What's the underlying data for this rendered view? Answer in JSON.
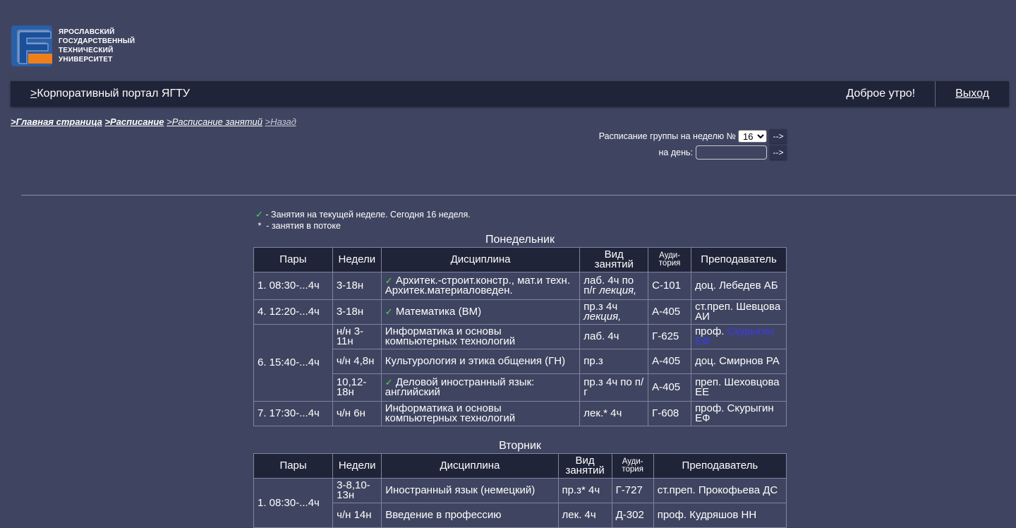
{
  "logo": {
    "lines": [
      "Ярославский",
      "государственный",
      "технический",
      "университет"
    ]
  },
  "navbar": {
    "portal_prefix": ">",
    "portal_label": "Корпоративный портал ЯГТУ",
    "greeting": "Доброе утро!",
    "logout": "Выход"
  },
  "breadcrumbs": {
    "home": ">Главная страница",
    "schedule": ">Расписание",
    "classes": ">Расписание занятий",
    "back": ">Назад"
  },
  "week_form": {
    "week_label": "Расписание группы на неделю №",
    "week_value": "16",
    "day_label": "на день:",
    "go": "-->"
  },
  "legend": {
    "check_text": " - Занятия на текущей неделе. Сегодня 16 неделя.",
    "star": "*",
    "star_text": "  - занятия в потоке"
  },
  "headers": {
    "pairs": "Пары",
    "weeks": "Недели",
    "discipline": "Дисциплина",
    "vid": "Вид занятий",
    "aud": "Ауди-тория",
    "teacher": "Преподаватель"
  },
  "monday": {
    "title": "Понедельник",
    "rows": [
      {
        "pair": "1. 08:30-...4ч",
        "weeks": "3-18н",
        "check": true,
        "discipline": "Архитек.-строит.констр., мат.и техн. Архитек.материаловеден.",
        "vid": "лаб. 4ч по п/г",
        "vid_extra": "лекция,",
        "aud": "С-101",
        "teacher": "доц. Лебедев АБ"
      },
      {
        "pair": "4. 12:20-...4ч",
        "weeks": "3-18н",
        "check": true,
        "discipline": "Математика (ВМ)",
        "vid": "пр.з 4ч",
        "vid_extra": "лекция,",
        "aud": "А-405",
        "teacher": "ст.преп. Шевцова АИ"
      },
      {
        "pair": "6. 15:40-...4ч",
        "weeks": "н/н 3-11н",
        "check": false,
        "discipline": "Информатика и основы компьютерных технологий",
        "vid": "лаб. 4ч",
        "vid_extra": "",
        "aud": "Г-625",
        "teacher_prefix": "проф.",
        "teacher": "Скурыгин ЕФ"
      },
      {
        "weeks": "ч/н 4,8н",
        "check": false,
        "discipline": "Культурология и этика общения (ГН)",
        "vid": "пр.з",
        "vid_extra": "",
        "aud": "А-405",
        "teacher": "доц. Смирнов РА"
      },
      {
        "weeks": "10,12-18н",
        "check": true,
        "discipline": "Деловой иностранный язык: английский",
        "vid": "пр.з 4ч по п/г",
        "vid_extra": "",
        "aud": "А-405",
        "teacher": "преп. Шеховцова ЕЕ"
      },
      {
        "pair": "7. 17:30-...4ч",
        "weeks": "ч/н 6н",
        "check": false,
        "discipline": "Информатика и основы компьютерных технологий",
        "vid": "лек.* 4ч",
        "vid_extra": "",
        "aud": "Г-608",
        "teacher": "проф. Скурыгин ЕФ"
      }
    ]
  },
  "tuesday": {
    "title": "Вторник",
    "rows": [
      {
        "pair": "1. 08:30-...4ч",
        "weeks": "3-8,10-13н",
        "discipline": "Иностранный язык (немецкий)",
        "vid": "пр.з* 4ч",
        "aud": "Г-727",
        "teacher": "ст.преп. Прокофьева ДС"
      },
      {
        "weeks": "ч/н 14н",
        "discipline": "Введение в профессию",
        "vid": "лек. 4ч",
        "aud": "Д-302",
        "teacher": "проф. Кудряшов НН"
      }
    ]
  }
}
